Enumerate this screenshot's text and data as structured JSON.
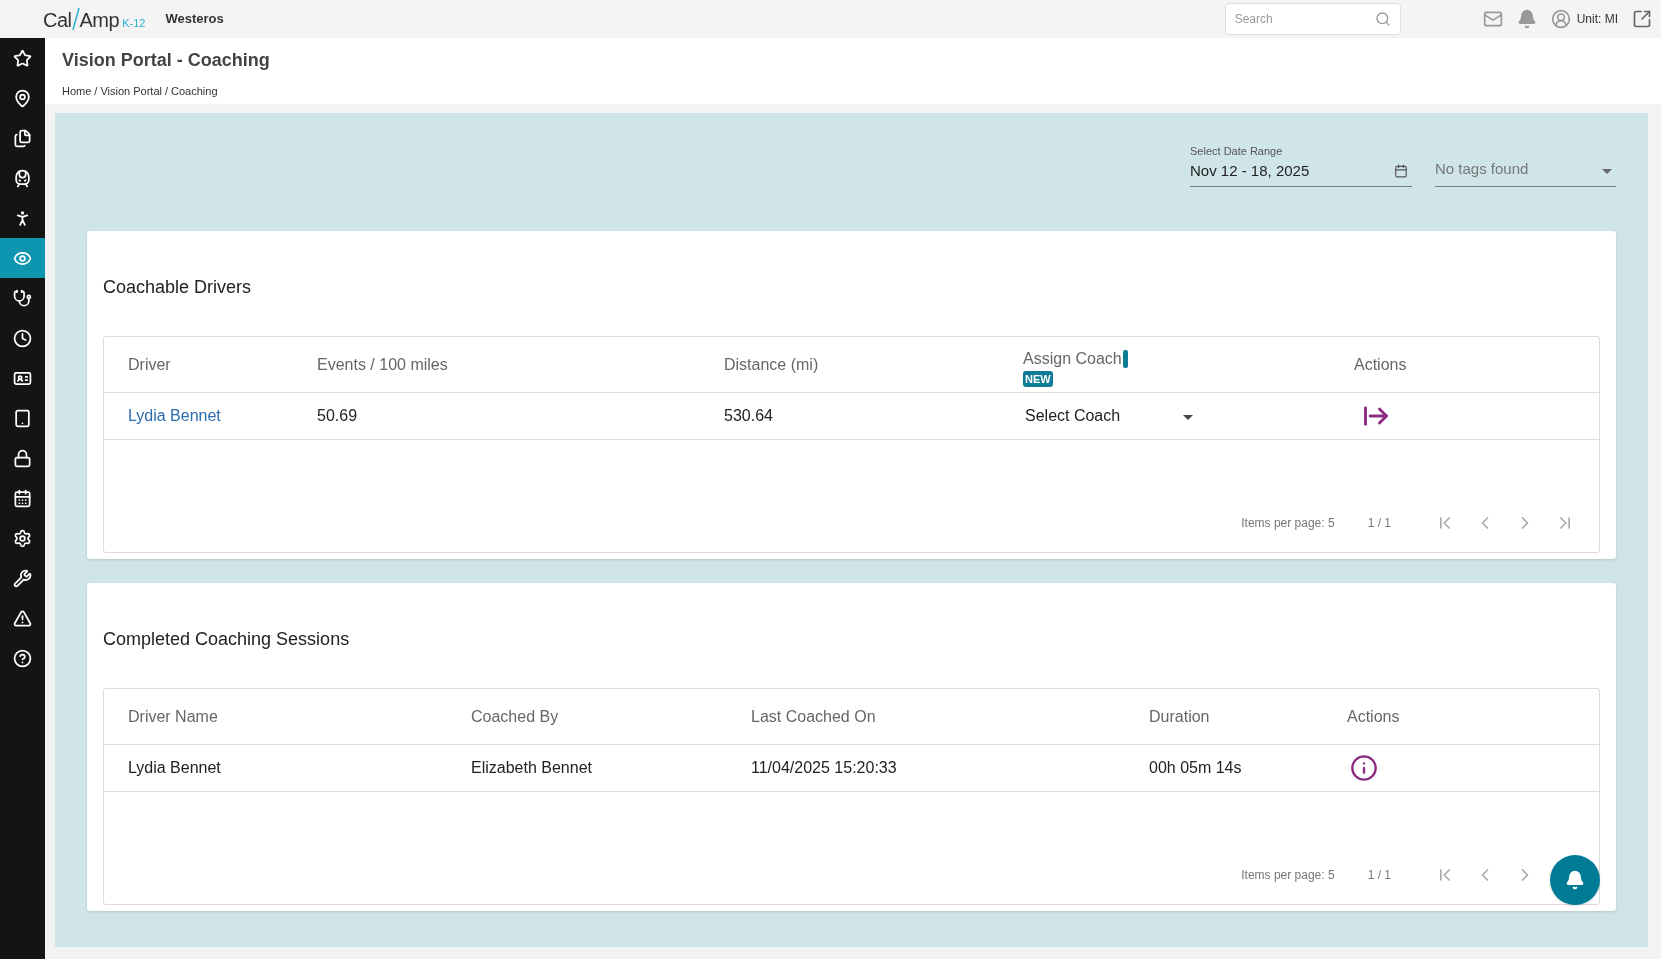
{
  "topbar": {
    "logo": {
      "left": "Cal",
      "right": "Amp",
      "suffix": "K-12"
    },
    "org": "Westeros",
    "search": {
      "placeholder": "Search"
    },
    "unit": "Unit: MI"
  },
  "sidebar": {
    "items": [
      {
        "selected": false
      },
      {
        "selected": false
      },
      {
        "selected": false
      },
      {
        "selected": false
      },
      {
        "selected": false
      },
      {
        "selected": true
      },
      {
        "selected": false
      },
      {
        "selected": false
      },
      {
        "selected": false
      },
      {
        "selected": false
      },
      {
        "selected": false
      },
      {
        "selected": false
      },
      {
        "selected": false
      },
      {
        "selected": false
      },
      {
        "selected": false
      },
      {
        "selected": false
      }
    ]
  },
  "page": {
    "title": "Vision Portal - Coaching",
    "breadcrumb": [
      "Home",
      "Vision Portal",
      "Coaching"
    ],
    "breadcrumb_separator": "/"
  },
  "filters": {
    "date_range": {
      "label": "Select Date Range",
      "value": "Nov 12 - 18, 2025"
    },
    "tags": {
      "placeholder": "No tags found"
    }
  },
  "cards": [
    {
      "title": "Coachable Drivers",
      "columns": [
        {
          "label": "Driver"
        },
        {
          "label": "Events / 100 miles"
        },
        {
          "label": "Distance (mi)"
        },
        {
          "label": "Assign Coach",
          "badge": "NEW"
        },
        {
          "label": "Actions"
        }
      ],
      "rows": [
        [
          {
            "kind": "link",
            "text": "Lydia Bennet"
          },
          {
            "kind": "text",
            "text": "50.69"
          },
          {
            "kind": "text",
            "text": "530.64"
          },
          {
            "kind": "select",
            "text": "Select Coach"
          },
          {
            "kind": "assign"
          }
        ]
      ],
      "pager": {
        "items_per_page": "Items per page: 5",
        "page": "1 / 1"
      }
    },
    {
      "title": "Completed Coaching Sessions",
      "columns": [
        {
          "label": "Driver Name"
        },
        {
          "label": "Coached By"
        },
        {
          "label": "Last Coached On"
        },
        {
          "label": "Duration"
        },
        {
          "label": "Actions"
        }
      ],
      "rows": [
        [
          {
            "kind": "text",
            "text": "Lydia Bennet"
          },
          {
            "kind": "text",
            "text": "Elizabeth Bennet"
          },
          {
            "kind": "text",
            "text": "11/04/2025 15:20:33"
          },
          {
            "kind": "text",
            "text": "00h 05m 14s"
          },
          {
            "kind": "info"
          }
        ]
      ],
      "pager": {
        "items_per_page": "Items per page: 5",
        "page": "1 / 1"
      }
    }
  ]
}
